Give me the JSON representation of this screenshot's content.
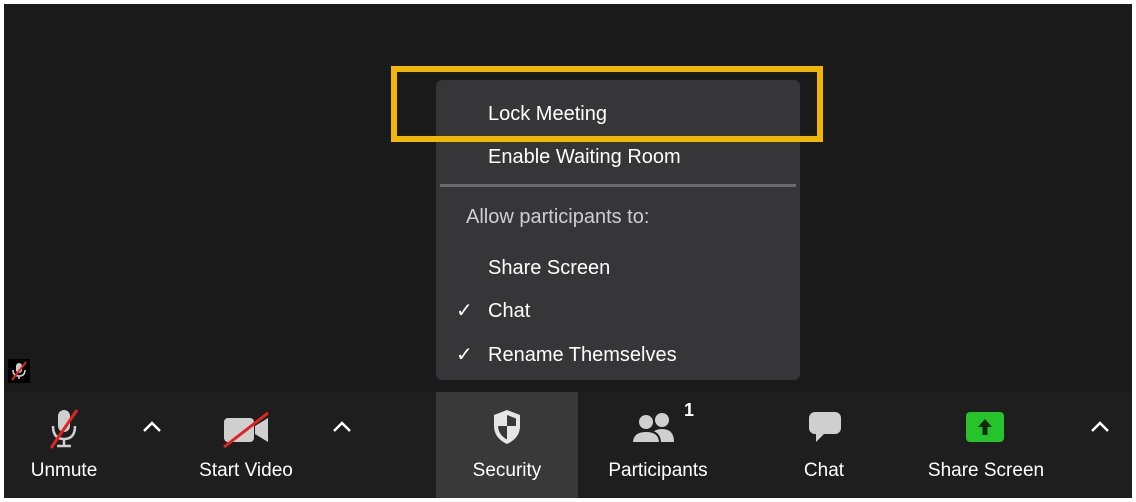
{
  "security_menu": {
    "lock_meeting": "Lock Meeting",
    "enable_waiting_room": "Enable Waiting Room",
    "allow_heading": "Allow participants to:",
    "options": [
      {
        "label": "Share Screen",
        "checked": false
      },
      {
        "label": "Chat",
        "checked": true
      },
      {
        "label": "Rename Themselves",
        "checked": true
      }
    ],
    "check_glyph": "✓"
  },
  "toolbar": {
    "unmute_label": "Unmute",
    "start_video_label": "Start Video",
    "security_label": "Security",
    "participants_label": "Participants",
    "participant_count": "1",
    "chat_label": "Chat",
    "share_screen_label": "Share Screen"
  },
  "colors": {
    "highlight": "#f2b705",
    "share_green": "#27c32a",
    "muted_red": "#e02424"
  },
  "icons": {
    "unmute": "microphone-muted-icon",
    "start_video": "video-camera-off-icon",
    "security": "shield-icon",
    "participants": "people-icon",
    "chat": "chat-bubble-icon",
    "share_screen": "share-screen-arrow-icon",
    "caret": "chevron-up-icon",
    "muted_indicator": "muted-mic-indicator-icon"
  }
}
